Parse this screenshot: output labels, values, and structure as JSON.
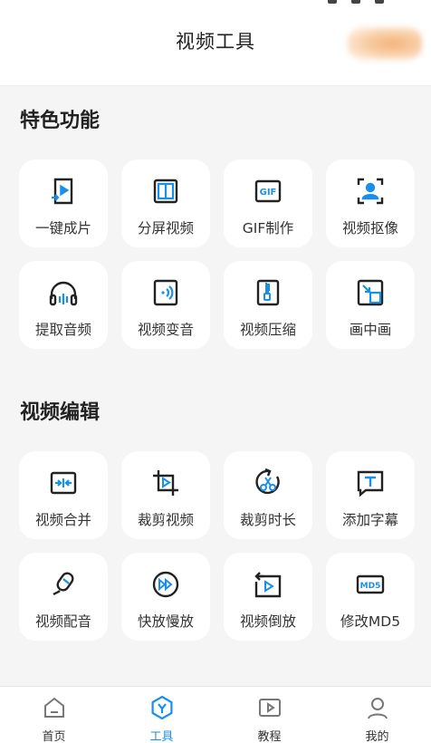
{
  "header": {
    "title": "视频工具"
  },
  "colors": {
    "accent": "#1a8fe8",
    "icon": "#222222",
    "tab_inactive": "#777777"
  },
  "sections": [
    {
      "title": "特色功能",
      "items": [
        {
          "label": "一键成片",
          "icon": "one-click-video-icon"
        },
        {
          "label": "分屏视频",
          "icon": "split-screen-icon"
        },
        {
          "label": "GIF制作",
          "icon": "gif-icon"
        },
        {
          "label": "视频抠像",
          "icon": "portrait-cutout-icon"
        },
        {
          "label": "提取音频",
          "icon": "headphones-icon"
        },
        {
          "label": "视频变音",
          "icon": "voice-change-icon"
        },
        {
          "label": "视频压缩",
          "icon": "compress-icon"
        },
        {
          "label": "画中画",
          "icon": "picture-in-picture-icon"
        }
      ]
    },
    {
      "title": "视频编辑",
      "items": [
        {
          "label": "视频合并",
          "icon": "merge-icon"
        },
        {
          "label": "裁剪视频",
          "icon": "crop-icon"
        },
        {
          "label": "裁剪时长",
          "icon": "trim-duration-icon"
        },
        {
          "label": "添加字幕",
          "icon": "subtitle-icon"
        },
        {
          "label": "视频配音",
          "icon": "dubbing-icon"
        },
        {
          "label": "快放慢放",
          "icon": "speed-icon"
        },
        {
          "label": "视频倒放",
          "icon": "reverse-icon"
        },
        {
          "label": "修改MD5",
          "icon": "md5-icon"
        }
      ]
    }
  ],
  "tabs": [
    {
      "label": "首页",
      "icon": "home-icon",
      "active": false
    },
    {
      "label": "工具",
      "icon": "tools-icon",
      "active": true
    },
    {
      "label": "教程",
      "icon": "tutorial-icon",
      "active": false
    },
    {
      "label": "我的",
      "icon": "profile-icon",
      "active": false
    }
  ]
}
